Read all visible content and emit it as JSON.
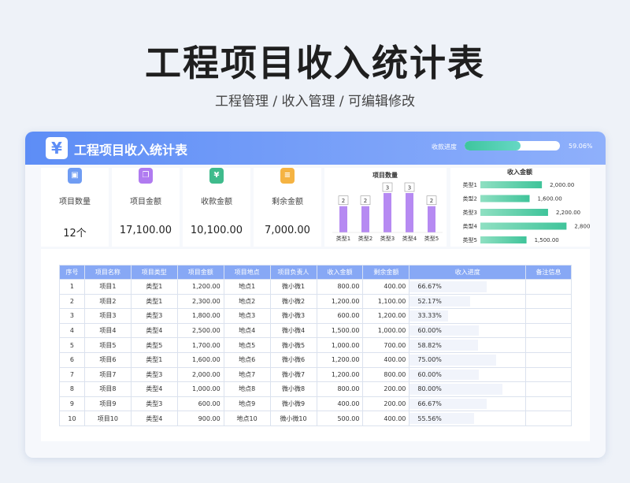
{
  "hero": {
    "title": "工程项目收入统计表",
    "subtitle": "工程管理 / 收入管理 / 可编辑修改"
  },
  "header": {
    "logo_glyph": "¥",
    "title": "工程项目收入统计表",
    "progress_label": "收款进度",
    "progress_value": "59.06%",
    "progress_fraction": 0.5906
  },
  "kpis": [
    {
      "label": "项目数量",
      "value": "12个",
      "icon": "monitor-icon",
      "color": "#6f9cf3"
    },
    {
      "label": "项目金额",
      "value": "17,100.00",
      "icon": "copy-icon",
      "color": "#b07bf0"
    },
    {
      "label": "收款金额",
      "value": "10,100.00",
      "icon": "yen-coin-icon",
      "color": "#3fbb8c"
    },
    {
      "label": "剩余金额",
      "value": "7,000.00",
      "icon": "document-icon",
      "color": "#f5b342"
    }
  ],
  "chart_data": [
    {
      "type": "bar",
      "title": "项目数量",
      "categories": [
        "类型1",
        "类型2",
        "类型3",
        "类型4",
        "类型5"
      ],
      "values": [
        2,
        2,
        3,
        3,
        2
      ],
      "ylim": [
        0,
        3.6
      ],
      "color": "#b68af2"
    },
    {
      "type": "bar",
      "orientation": "horizontal",
      "title": "收入金额",
      "categories": [
        "类型1",
        "类型2",
        "类型3",
        "类型4",
        "类型5"
      ],
      "values": [
        2000,
        1600,
        2200,
        2800,
        1500
      ],
      "value_labels": [
        "2,000.00",
        "1,600.00",
        "2,200.00",
        "2,800.00",
        "1,500.00"
      ],
      "xlim": [
        0,
        3200
      ],
      "color": "#3fc49a"
    }
  ],
  "table": {
    "headers": [
      "序号",
      "项目名称",
      "项目类型",
      "项目金额",
      "项目地点",
      "项目负责人",
      "收入金额",
      "剩余金额",
      "收入进度",
      "备注信息"
    ],
    "rows": [
      {
        "no": "1",
        "name": "项目1",
        "type": "类型1",
        "amount": "1,200.00",
        "place": "地点1",
        "owner": "微小微1",
        "income": "800.00",
        "remain": "400.00",
        "progress": "66.67%",
        "fraction": 0.6667,
        "note": ""
      },
      {
        "no": "2",
        "name": "项目2",
        "type": "类型1",
        "amount": "2,300.00",
        "place": "地点2",
        "owner": "微小微2",
        "income": "1,200.00",
        "remain": "1,100.00",
        "progress": "52.17%",
        "fraction": 0.5217,
        "note": ""
      },
      {
        "no": "3",
        "name": "项目3",
        "type": "类型3",
        "amount": "1,800.00",
        "place": "地点3",
        "owner": "微小微3",
        "income": "600.00",
        "remain": "1,200.00",
        "progress": "33.33%",
        "fraction": 0.3333,
        "note": ""
      },
      {
        "no": "4",
        "name": "项目4",
        "type": "类型4",
        "amount": "2,500.00",
        "place": "地点4",
        "owner": "微小微4",
        "income": "1,500.00",
        "remain": "1,000.00",
        "progress": "60.00%",
        "fraction": 0.6,
        "note": ""
      },
      {
        "no": "5",
        "name": "项目5",
        "type": "类型5",
        "amount": "1,700.00",
        "place": "地点5",
        "owner": "微小微5",
        "income": "1,000.00",
        "remain": "700.00",
        "progress": "58.82%",
        "fraction": 0.5882,
        "note": ""
      },
      {
        "no": "6",
        "name": "项目6",
        "type": "类型1",
        "amount": "1,600.00",
        "place": "地点6",
        "owner": "微小微6",
        "income": "1,200.00",
        "remain": "400.00",
        "progress": "75.00%",
        "fraction": 0.75,
        "note": ""
      },
      {
        "no": "7",
        "name": "项目7",
        "type": "类型3",
        "amount": "2,000.00",
        "place": "地点7",
        "owner": "微小微7",
        "income": "1,200.00",
        "remain": "800.00",
        "progress": "60.00%",
        "fraction": 0.6,
        "note": ""
      },
      {
        "no": "8",
        "name": "项目8",
        "type": "类型4",
        "amount": "1,000.00",
        "place": "地点8",
        "owner": "微小微8",
        "income": "800.00",
        "remain": "200.00",
        "progress": "80.00%",
        "fraction": 0.8,
        "note": ""
      },
      {
        "no": "9",
        "name": "项目9",
        "type": "类型3",
        "amount": "600.00",
        "place": "地点9",
        "owner": "微小微9",
        "income": "400.00",
        "remain": "200.00",
        "progress": "66.67%",
        "fraction": 0.6667,
        "note": ""
      },
      {
        "no": "10",
        "name": "项目10",
        "type": "类型4",
        "amount": "900.00",
        "place": "地点10",
        "owner": "微小微10",
        "income": "500.00",
        "remain": "400.00",
        "progress": "55.56%",
        "fraction": 0.5556,
        "note": ""
      }
    ]
  }
}
